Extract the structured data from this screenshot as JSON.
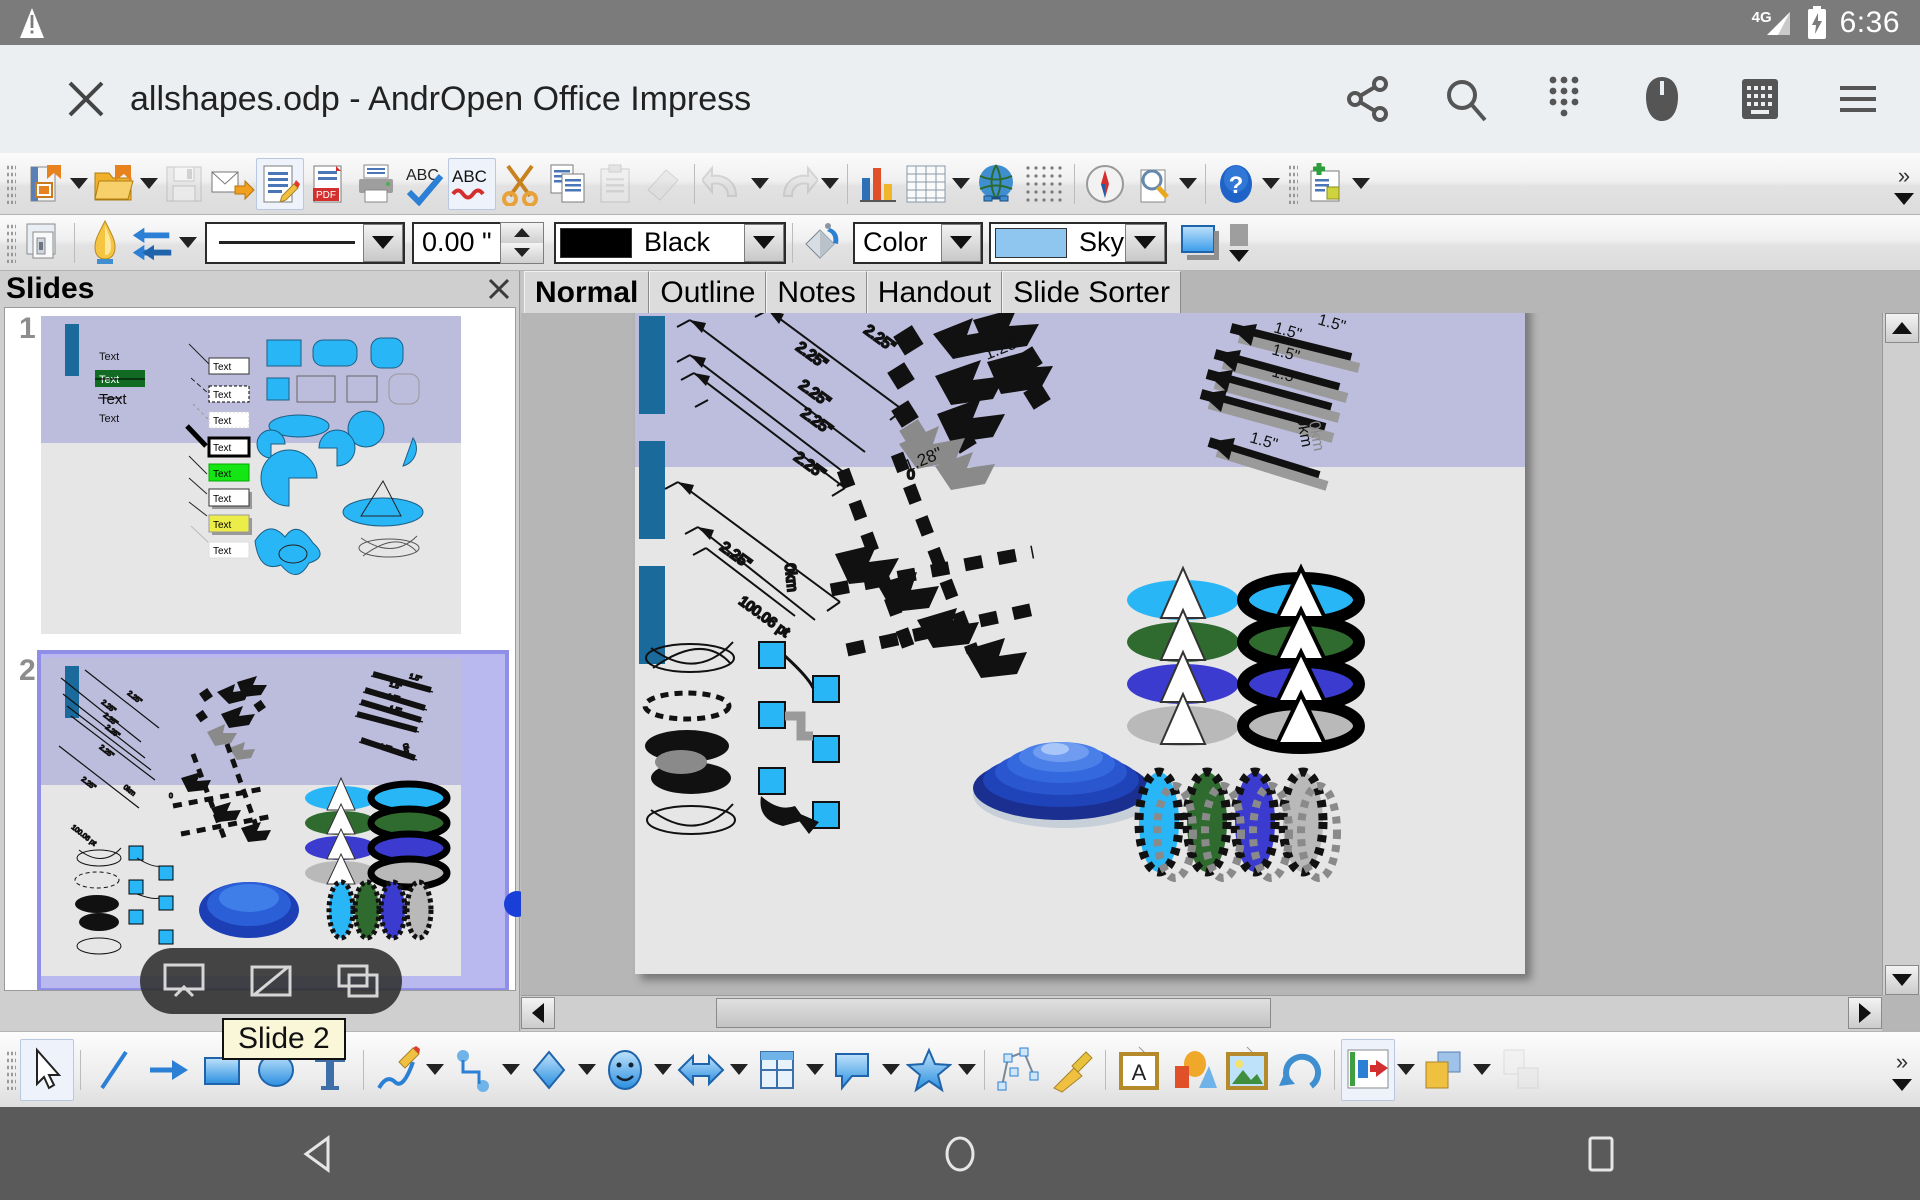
{
  "status_bar": {
    "warning_icon": "warning-triangle-icon",
    "network_label": "4G",
    "signal_icon": "signal-bars-icon",
    "battery_icon": "battery-charging-icon",
    "clock": "6:36"
  },
  "titlebar": {
    "close_label": "close-icon",
    "title": "allshapes.odp - AndrOpen Office Impress",
    "actions": [
      {
        "name": "share-icon",
        "label": "Share"
      },
      {
        "name": "search-icon",
        "label": "Search"
      },
      {
        "name": "apps-grid-icon",
        "label": "Apps"
      },
      {
        "name": "mouse-icon",
        "label": "Mouse"
      },
      {
        "name": "keyboard-icon",
        "label": "Keyboard"
      },
      {
        "name": "menu-icon",
        "label": "Menu"
      }
    ]
  },
  "toolbar_main": {
    "items": [
      {
        "name": "new-document-button",
        "label": "New",
        "dropdown": true
      },
      {
        "name": "open-document-button",
        "label": "Open",
        "dropdown": true
      },
      {
        "name": "save-button",
        "label": "Save",
        "disabled": true
      },
      {
        "name": "send-email-button",
        "label": "Document as E-mail"
      },
      {
        "name": "edit-file-button",
        "label": "Edit File",
        "framed": true
      },
      {
        "name": "export-pdf-button",
        "label": "Export as PDF"
      },
      {
        "name": "print-button",
        "label": "Print File Directly"
      },
      {
        "name": "spelling-button",
        "label": "Spelling and Grammar"
      },
      {
        "name": "autospellcheck-button",
        "label": "AutoSpellcheck",
        "framed": true
      },
      {
        "name": "cut-button",
        "label": "Cut"
      },
      {
        "name": "copy-button",
        "label": "Copy"
      },
      {
        "name": "paste-button",
        "label": "Paste",
        "disabled": true
      },
      {
        "name": "clone-formatting-button",
        "label": "Clone Formatting",
        "disabled": true
      },
      {
        "name": "undo-button",
        "label": "Undo",
        "disabled": true,
        "dropdown": true
      },
      {
        "name": "redo-button",
        "label": "Redo",
        "disabled": true,
        "dropdown": true
      },
      {
        "name": "insert-chart-button",
        "label": "Chart"
      },
      {
        "name": "insert-table-button",
        "label": "Table",
        "dropdown": true
      },
      {
        "name": "hyperlink-button",
        "label": "Hyperlink"
      },
      {
        "name": "display-grid-button",
        "label": "Display Grid"
      },
      {
        "name": "navigator-button",
        "label": "Navigator"
      },
      {
        "name": "zoom-button",
        "label": "Zoom",
        "dropdown": true
      },
      {
        "name": "help-button",
        "label": "Help"
      },
      {
        "name": "new-slide-button",
        "label": "New Slide",
        "dropdown": true
      }
    ],
    "overflow_label": "»"
  },
  "toolbar_line_fill": {
    "items": [
      {
        "name": "slide-properties-button",
        "label": "Slide Properties"
      },
      {
        "name": "line-style-dialog-button",
        "label": "Line"
      },
      {
        "name": "arrow-style-button",
        "label": "Arrow Style",
        "dropdown": true
      }
    ],
    "line_style": {
      "name": "line-style-select",
      "value": "————"
    },
    "line_width": {
      "name": "line-width-field",
      "value": "0.00 \"",
      "placeholder": "0.00 \""
    },
    "line_color": {
      "name": "line-color-select",
      "value": "Black",
      "swatch": "#000000"
    },
    "area_style_button": {
      "name": "area-style-button",
      "label": "Area"
    },
    "fill_type": {
      "name": "fill-type-select",
      "value": "Color"
    },
    "fill_color": {
      "name": "fill-color-select",
      "value": "Sky blu",
      "swatch": "#8ec6f0"
    },
    "shadow_button": {
      "name": "shadow-toggle-button",
      "label": "Shadow",
      "swatch": "#4aa3f0"
    }
  },
  "slides_panel": {
    "title": "Slides",
    "close": "close-icon",
    "slides": [
      {
        "number": "1",
        "selected": false,
        "name": "slide-thumbnail-1"
      },
      {
        "number": "2",
        "selected": true,
        "name": "slide-thumbnail-2"
      }
    ],
    "tooltip": "Slide 2"
  },
  "float_toolbar": {
    "items": [
      {
        "name": "start-slideshow-icon",
        "label": "Start Slideshow"
      },
      {
        "name": "toggle-display-icon",
        "label": "Toggle Display"
      },
      {
        "name": "duplicate-window-icon",
        "label": "Duplicate Window"
      }
    ]
  },
  "editor": {
    "tabs": [
      {
        "name": "tab-normal",
        "label": "Normal",
        "active": true
      },
      {
        "name": "tab-outline",
        "label": "Outline",
        "active": false
      },
      {
        "name": "tab-notes",
        "label": "Notes",
        "active": false
      },
      {
        "name": "tab-handout",
        "label": "Handout",
        "active": false
      },
      {
        "name": "tab-slide-sorter",
        "label": "Slide Sorter",
        "active": false
      }
    ],
    "slide_content": {
      "dimension_labels_left": [
        "2.25\"",
        "2.25\"",
        "2.25\"",
        "2.25\"",
        "2.25\"",
        "2.25\""
      ],
      "dimension_labels_right": [
        "1.5\"",
        "1.5\"",
        "1.5\"",
        "1.5\"",
        "1.5\"",
        "1.5\""
      ],
      "unit_labels": [
        "0km",
        "0km",
        "0km"
      ],
      "misc_labels": [
        "1.28\"",
        "1.28\"",
        "1.28\"",
        "0",
        "100.06 pt"
      ],
      "theme_band_color": "#bdbdde",
      "background_color": "#e6e6e6",
      "accent_bar_color": "#1b6a9c",
      "shape_fill_color": "#29b6f6"
    }
  },
  "draw_toolbar": {
    "items": [
      {
        "name": "select-tool",
        "label": "Select",
        "active": true
      },
      {
        "name": "line-tool",
        "label": "Line"
      },
      {
        "name": "arrow-line-tool",
        "label": "Line Ends with Arrow"
      },
      {
        "name": "rectangle-tool",
        "label": "Rectangle"
      },
      {
        "name": "ellipse-tool",
        "label": "Ellipse"
      },
      {
        "name": "text-tool",
        "label": "Text"
      },
      {
        "name": "curve-tool",
        "label": "Curve",
        "dropdown": true
      },
      {
        "name": "connector-tool",
        "label": "Connector",
        "dropdown": true
      },
      {
        "name": "basic-shapes-tool",
        "label": "Basic Shapes",
        "dropdown": true
      },
      {
        "name": "symbol-shapes-tool",
        "label": "Symbol Shapes",
        "dropdown": true
      },
      {
        "name": "block-arrows-tool",
        "label": "Block Arrows",
        "dropdown": true
      },
      {
        "name": "flowchart-tool",
        "label": "Flowchart",
        "dropdown": true
      },
      {
        "name": "callouts-tool",
        "label": "Callouts",
        "dropdown": true
      },
      {
        "name": "stars-tool",
        "label": "Stars",
        "dropdown": true
      },
      {
        "name": "points-tool",
        "label": "Points"
      },
      {
        "name": "glue-points-tool",
        "label": "Glue Points"
      },
      {
        "name": "fontwork-tool",
        "label": "Fontwork Gallery"
      },
      {
        "name": "gallery-tool",
        "label": "Gallery"
      },
      {
        "name": "insert-image-tool",
        "label": "Insert Image"
      },
      {
        "name": "rotate-tool",
        "label": "Rotate"
      },
      {
        "name": "alignment-tool",
        "label": "Alignment",
        "dropdown": true
      },
      {
        "name": "arrange-tool",
        "label": "Arrange",
        "dropdown": true
      },
      {
        "name": "shadow-tool",
        "label": "Shadow",
        "disabled": true
      }
    ],
    "overflow_label": "»"
  },
  "navbar": {
    "items": [
      {
        "name": "back-button",
        "label": "Back"
      },
      {
        "name": "home-button",
        "label": "Home"
      },
      {
        "name": "recents-button",
        "label": "Recents"
      }
    ]
  }
}
